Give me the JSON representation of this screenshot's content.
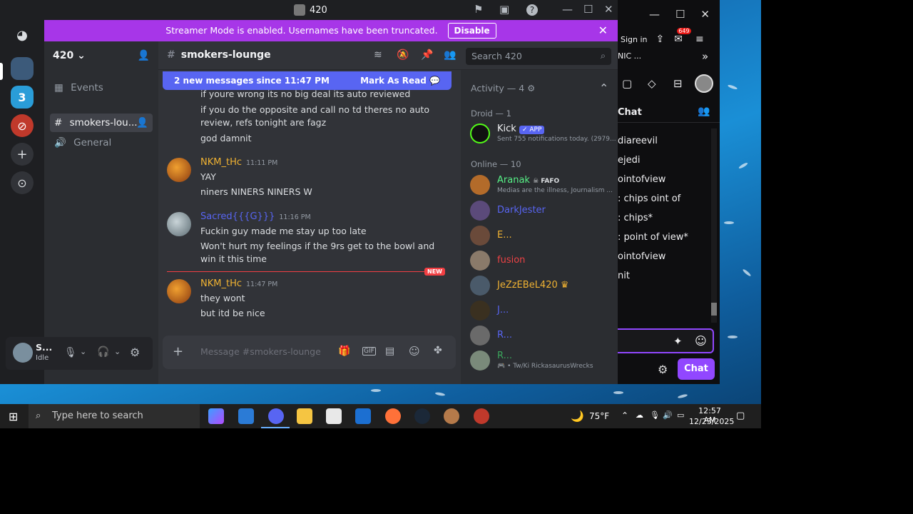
{
  "window": {
    "title": "420"
  },
  "banner": {
    "text": "Streamer Mode is enabled. Usernames have been truncated.",
    "disable_label": "Disable"
  },
  "guild": {
    "name": "420"
  },
  "channels": {
    "events_label": "Events",
    "items": [
      "smokers-lou...",
      "General"
    ]
  },
  "channel_header": {
    "name": "smokers-lounge",
    "search_placeholder": "Search 420"
  },
  "new_messages": {
    "text": "2 new messages since 11:47 PM",
    "mark_read": "Mark As Read"
  },
  "messages": {
    "cont_lines": [
      "if youre wrong its no big deal its auto reviewed",
      "if you do the opposite and call no td theres no auto review, refs tonight are fagz",
      "god damnit"
    ],
    "groups": [
      {
        "author": "NKM_tHc",
        "time": "11:11 PM",
        "lines": [
          "YAY",
          "niners NINERS NINERS W"
        ]
      },
      {
        "author": "Sacred{{{G}}}",
        "time": "11:16 PM",
        "lines": [
          "Fuckin guy made me stay up too late",
          "Won't hurt my feelings if the 9rs get to the bowl and win it this time"
        ]
      },
      {
        "author": "NKM_tHc",
        "time": "11:47 PM",
        "lines": [
          "they wont",
          "but itd be nice"
        ]
      }
    ],
    "new_tag": "NEW"
  },
  "composer": {
    "placeholder": "Message #smokers-lounge"
  },
  "user": {
    "name": "S...",
    "status": "Idle"
  },
  "members": {
    "activity": "Activity — 4",
    "droid_header": "Droid — 1",
    "online_header": "Online — 10",
    "droid": {
      "name": "Kick",
      "badge": "APP",
      "sub": "Sent 755 notifications today. (2979..."
    },
    "online": [
      {
        "name": "Aranak",
        "badge": "FAFO",
        "sub": "Medias are the illness, Journalism ...",
        "color": "#57f287"
      },
      {
        "name": "DarkJester",
        "sub": "",
        "color": "#5865f2"
      },
      {
        "name": "E...",
        "sub": "",
        "color": "#f0b232"
      },
      {
        "name": "fusion",
        "sub": "",
        "color": "#ed4245"
      },
      {
        "name": "JeZzEBeL420",
        "sub": "",
        "color": "#f0b232"
      },
      {
        "name": "J...",
        "sub": "",
        "color": "#5865f2"
      },
      {
        "name": "R...",
        "sub": "",
        "color": "#5865f2"
      },
      {
        "name": "R...",
        "sub": "• Tw/Ki RickasaurusWrecks",
        "color": "#3ba55c"
      }
    ]
  },
  "browser": {
    "sign_in": "Sign in",
    "badge": "649",
    "tab": "NIC ...",
    "chat_title": "Chat",
    "chat_lines": [
      "diareevil",
      "ejedi",
      "ointofview",
      ": chips oint of",
      ": chips*",
      ": point of view*",
      "ointofview",
      "nit"
    ],
    "chat_button": "Chat"
  },
  "taskbar": {
    "search": "Type here to search",
    "weather": "75°F",
    "time": "12:57 AM",
    "date": "12/23/2025"
  }
}
